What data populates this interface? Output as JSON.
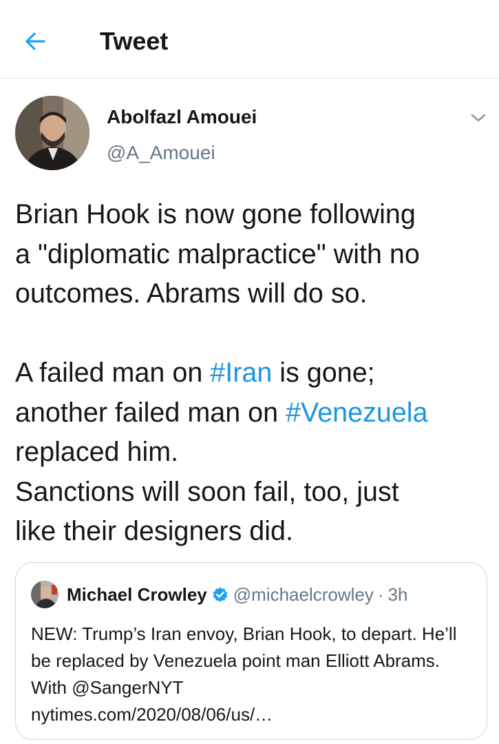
{
  "header": {
    "title": "Tweet",
    "back_icon": "arrow-left-icon",
    "accent": "#1da1f2"
  },
  "tweet": {
    "author_name": "Abolfazl Amouei",
    "author_handle": "@A_Amouei",
    "text_part1": "Brian Hook is now gone following\na \"diplomatic malpractice\" with no\noutcomes. Abrams will do so.\n\nA failed man on ",
    "hashtag1": "#Iran",
    "text_part2": " is gone;\nanother failed man on ",
    "hashtag2": "#Venezuela",
    "text_part3": "\nreplaced him.\nSanctions will soon fail, too, just\nlike their designers did.",
    "hashtag_color": "#1b95e0"
  },
  "quote": {
    "author_name": "Michael Crowley",
    "verified_icon": "verified-badge-icon",
    "author_handle": "@michaelcrowley",
    "separator": "·",
    "time": "3h",
    "text": "NEW: Trump’s Iran envoy, Brian Hook, to depart. He’ll be replaced by Venezuela point man Elliott Abrams. With @SangerNYT",
    "link": "nytimes.com/2020/08/06/us/…"
  }
}
